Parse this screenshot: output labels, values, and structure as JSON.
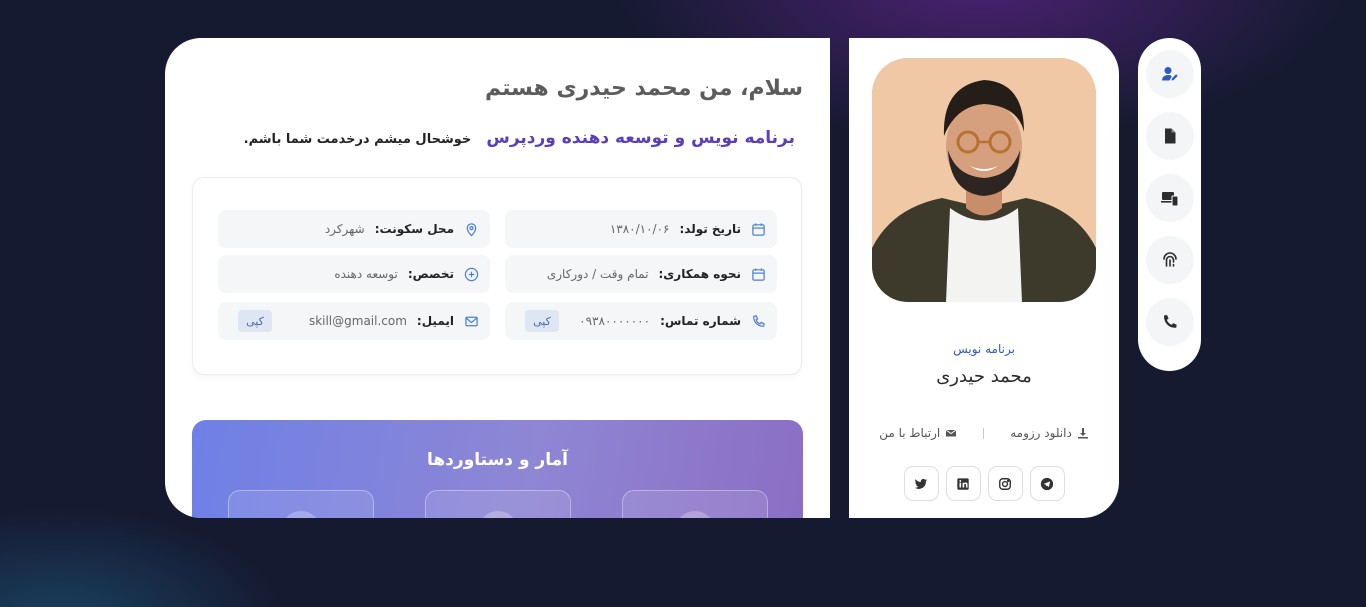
{
  "colors": {
    "background": "#161a31",
    "accent": "#2f58c5",
    "headline_accent": "#5a3fb8",
    "card": "#ffffff"
  },
  "intro": {
    "title": "سلام، من محمد حیدری هستم",
    "role_highlight": "برنامه نویس و توسعه دهنده وردپرس",
    "welcome": "خوشحال میشم درخدمت شما باشم."
  },
  "info": {
    "birth_date": {
      "icon": "calendar-icon",
      "label": "تاریخ تولد:",
      "value": "۱۳۸۰/۱۰/۰۶"
    },
    "location": {
      "icon": "location-pin-icon",
      "label": "محل سکونت:",
      "value": "شهرکرد"
    },
    "cooperation": {
      "icon": "calendar-icon",
      "label": "نحوه همکاری:",
      "value": "تمام وقت / دورکاری"
    },
    "specialty": {
      "icon": "plus-circle-icon",
      "label": "تخصص:",
      "value": "توسعه دهنده"
    },
    "phone": {
      "icon": "phone-icon",
      "label": "شماره تماس:",
      "value": "۰۹۳۸۰۰۰۰۰۰۰",
      "copy_label": "کپی"
    },
    "email": {
      "icon": "envelope-icon",
      "label": "ایمیل:",
      "value": "skill@gmail.com",
      "copy_label": "کپی"
    }
  },
  "stats": {
    "title": "آمار و دستاوردها"
  },
  "profile": {
    "role": "برنامه نویس",
    "name": "محمد حیدری",
    "download_resume": "دانلود رزومه",
    "contact_me": "ارتباط با من",
    "socials": [
      "telegram-icon",
      "instagram-icon",
      "linkedin-icon",
      "twitter-icon"
    ]
  },
  "nav": {
    "items": [
      "user-edit-icon",
      "document-icon",
      "devices-icon",
      "fingerprint-icon",
      "phone-icon"
    ],
    "active_index": 0
  }
}
